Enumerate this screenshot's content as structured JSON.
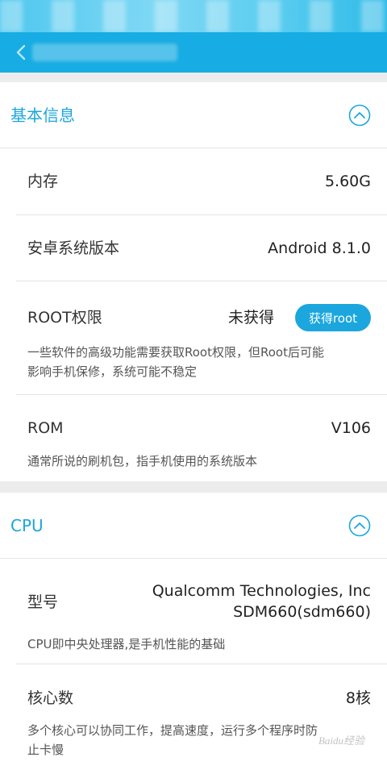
{
  "sections": {
    "basic": {
      "title": "基本信息"
    },
    "cpu": {
      "title": "CPU"
    }
  },
  "basic_rows": {
    "memory": {
      "label": "内存",
      "value": "5.60G"
    },
    "android_version": {
      "label": "安卓系统版本",
      "value": "Android 8.1.0"
    },
    "root": {
      "label": "ROOT权限",
      "status": "未获得",
      "button_label": "获得root",
      "desc_line1": "一些软件的高级功能需要获取Root权限，但Root后可能",
      "desc_line2": "影响手机保修，系统可能不稳定"
    },
    "rom": {
      "label": "ROM",
      "value": "V106",
      "desc": "通常所说的刷机包，指手机使用的系统版本"
    }
  },
  "cpu_rows": {
    "model": {
      "label": "型号",
      "value_line1": "Qualcomm Technologies, Inc",
      "value_line2": "SDM660(sdm660)",
      "desc": "CPU即中央处理器,是手机性能的基础"
    },
    "cores": {
      "label": "核心数",
      "value": "8核",
      "desc_line1": "多个核心可以协同工作，提高速度，运行多个程序时防",
      "desc_line2": "止卡慢"
    }
  },
  "icons": {
    "back": "chevron-left-icon",
    "collapse": "chevron-up-circle-icon"
  },
  "colors": {
    "accent": "#1ba6de",
    "app_bar": "#17ace3",
    "strip": "#ececec"
  },
  "watermark": {
    "text": "Baidu经验"
  }
}
